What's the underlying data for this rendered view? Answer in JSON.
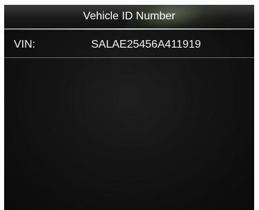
{
  "header": {
    "title": "Vehicle ID Number"
  },
  "vin": {
    "label": "VIN:",
    "value": "SALAE25456A411919"
  },
  "colors": {
    "background": "#0d0d0d",
    "text": "#ffffff",
    "rule": "#c8c8c8"
  }
}
